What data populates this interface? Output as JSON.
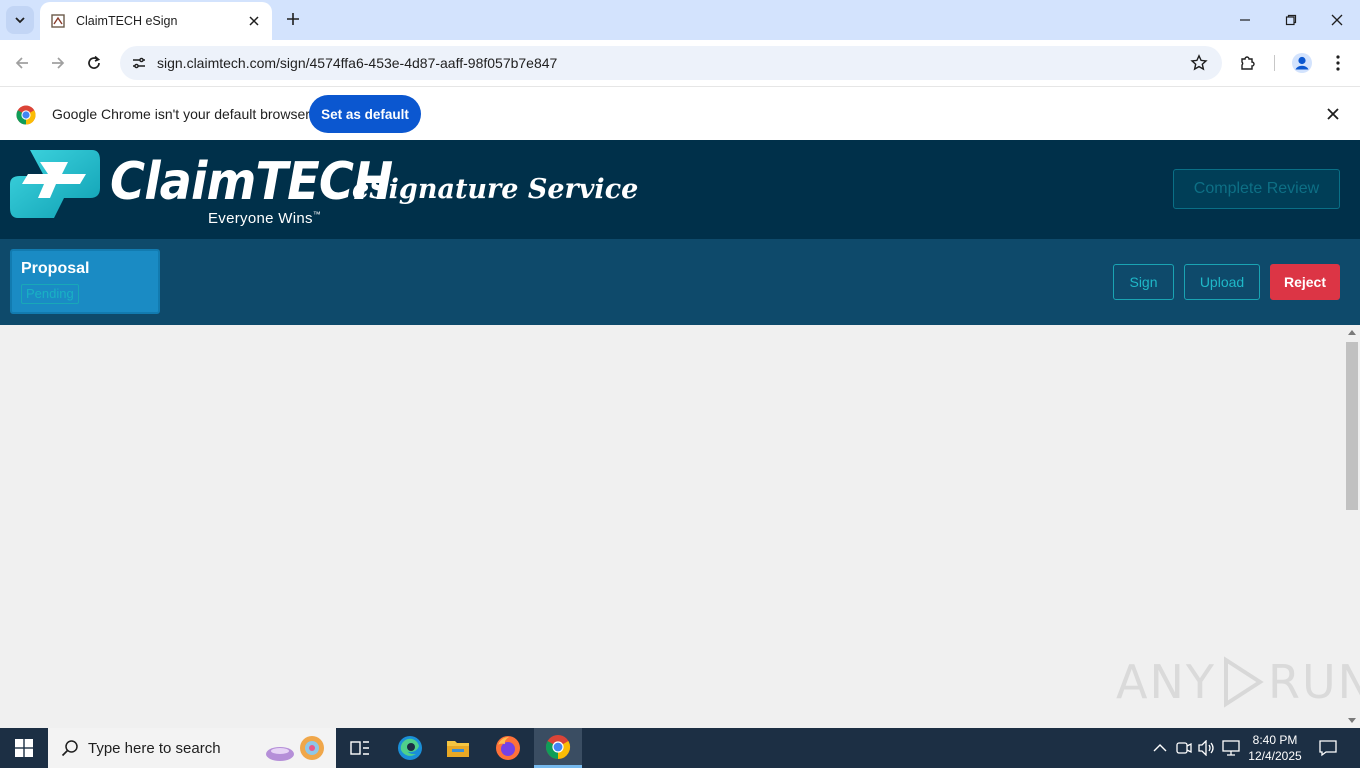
{
  "browser": {
    "tab_title": "ClaimTECH eSign",
    "url": "sign.claimtech.com/sign/4574ffa6-453e-4d87-aaff-98f057b7e847",
    "infobar_text": "Google Chrome isn't your default browser",
    "infobar_button": "Set as default"
  },
  "site": {
    "brand": "ClaimTECH",
    "tagline": "Everyone Wins",
    "trademark": "™",
    "service_title": "eSignature Service",
    "complete_review_label": "Complete Review",
    "colors": {
      "header_bg": "#00304a",
      "docbar_bg": "#0e4a6b",
      "accent": "#1fb8c8",
      "reject": "#dc3545"
    }
  },
  "document": {
    "name": "Proposal",
    "status": "Pending"
  },
  "actions": {
    "sign_label": "Sign",
    "upload_label": "Upload",
    "reject_label": "Reject"
  },
  "watermark": {
    "left": "ANY",
    "right": "RUN"
  },
  "taskbar": {
    "search_placeholder": "Type here to search",
    "time": "8:40 PM",
    "date": "12/4/2025",
    "apps": [
      "task-view",
      "edge",
      "file-explorer",
      "firefox",
      "chrome"
    ]
  }
}
